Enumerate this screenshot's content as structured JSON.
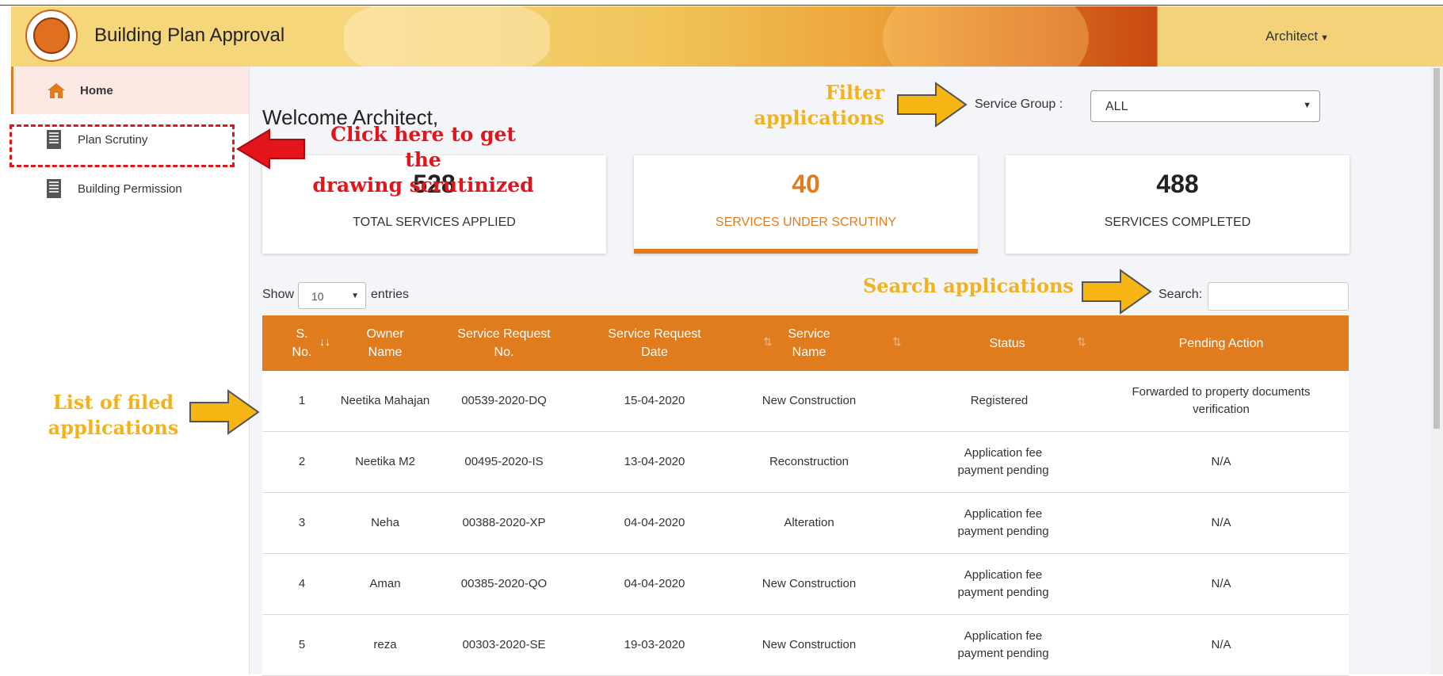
{
  "app": {
    "title": "Building Plan Approval",
    "user_menu": "Architect"
  },
  "sidebar": {
    "items": [
      {
        "label": "Home",
        "icon": "home-icon",
        "active": true
      },
      {
        "label": "Plan Scrutiny",
        "icon": "building-icon",
        "active": false
      },
      {
        "label": "Building Permission",
        "icon": "building-icon",
        "active": false
      }
    ]
  },
  "main": {
    "welcome": "Welcome Architect,",
    "service_group": {
      "label": "Service Group :",
      "selected": "ALL"
    },
    "cards": [
      {
        "value": "528",
        "caption": "TOTAL SERVICES APPLIED"
      },
      {
        "value": "40",
        "caption": "SERVICES UNDER SCRUTINY"
      },
      {
        "value": "488",
        "caption": "SERVICES COMPLETED"
      }
    ],
    "show_label": "Show",
    "entries_value": "10",
    "entries_label": "entries",
    "search_label": "Search:"
  },
  "table": {
    "columns": [
      "S. No.",
      "Owner Name",
      "Service Request No.",
      "Service Request Date",
      "Service Name",
      "Status",
      "Pending Action"
    ],
    "rows": [
      [
        "1",
        "Neetika Mahajan",
        "00539-2020-DQ",
        "15-04-2020",
        "New Construction",
        "Registered",
        "Forwarded to property documents verification"
      ],
      [
        "2",
        "Neetika M2",
        "00495-2020-IS",
        "13-04-2020",
        "Reconstruction",
        "Application fee payment pending",
        "N/A"
      ],
      [
        "3",
        "Neha",
        "00388-2020-XP",
        "04-04-2020",
        "Alteration",
        "Application fee payment pending",
        "N/A"
      ],
      [
        "4",
        "Aman",
        "00385-2020-QO",
        "04-04-2020",
        "New Construction",
        "Application fee payment pending",
        "N/A"
      ],
      [
        "5",
        "reza",
        "00303-2020-SE",
        "19-03-2020",
        "New Construction",
        "Application fee payment pending",
        "N/A"
      ]
    ]
  },
  "annotations": {
    "filter": [
      "Filter",
      "applications"
    ],
    "plan_scrutiny": [
      "Click here to get the",
      "drawing scrutinized"
    ],
    "search": "Search applications",
    "list": [
      "List of filed",
      "applications"
    ]
  },
  "colors": {
    "accent": "#e07b1e",
    "annotation_gold": "#f3b21c",
    "annotation_red": "#e4151a"
  }
}
